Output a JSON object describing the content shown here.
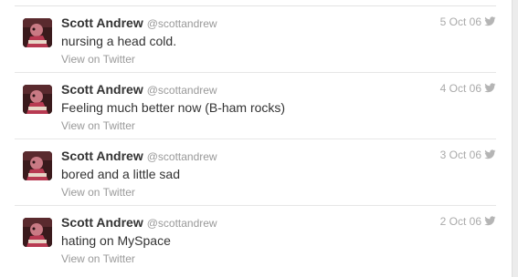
{
  "tweets": [
    {
      "name": "Scott Andrew",
      "handle": "@scottandrew",
      "date": "5 Oct 06",
      "text": "nursing a head cold.",
      "link": "View on Twitter"
    },
    {
      "name": "Scott Andrew",
      "handle": "@scottandrew",
      "date": "4 Oct 06",
      "text": "Feeling much better now (B-ham rocks)",
      "link": "View on Twitter"
    },
    {
      "name": "Scott Andrew",
      "handle": "@scottandrew",
      "date": "3 Oct 06",
      "text": "bored and a little sad",
      "link": "View on Twitter"
    },
    {
      "name": "Scott Andrew",
      "handle": "@scottandrew",
      "date": "2 Oct 06",
      "text": "hating on MySpace",
      "link": "View on Twitter"
    }
  ],
  "icons": {
    "service": "twitter-bird-icon",
    "avatar": "user-avatar"
  },
  "colors": {
    "name": "#333333",
    "muted": "#999999",
    "divider": "#e6e6e6"
  }
}
